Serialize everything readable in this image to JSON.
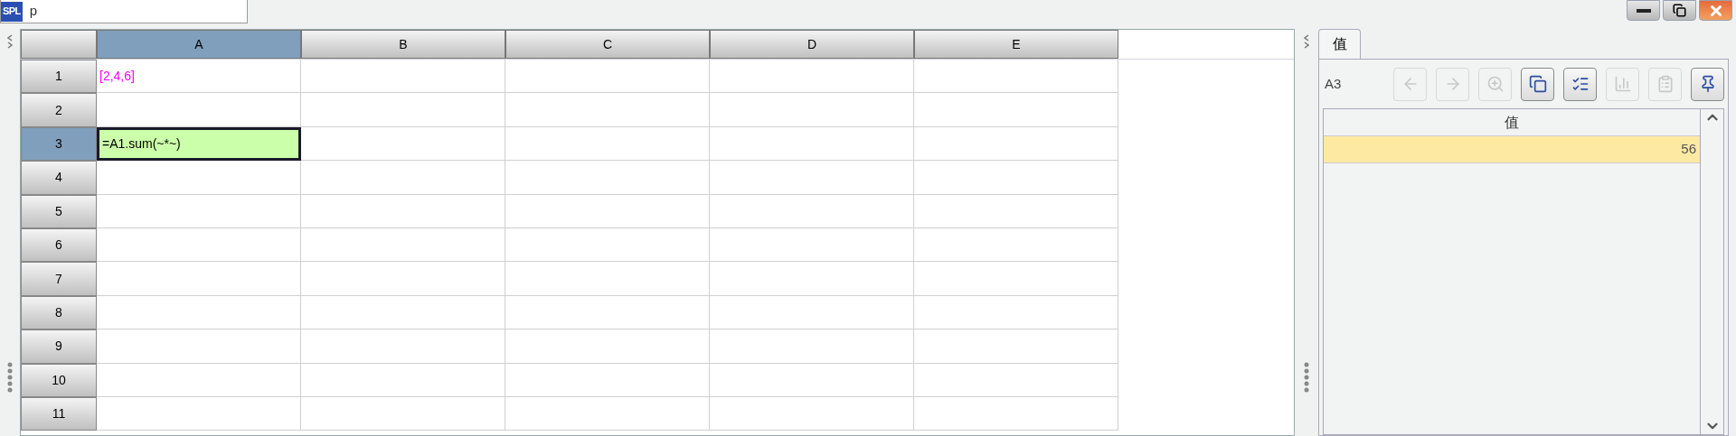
{
  "document_tab": {
    "logo": "SPL",
    "title": "p"
  },
  "grid": {
    "columns": [
      {
        "label": "A",
        "selected": true
      },
      {
        "label": "B",
        "selected": false
      },
      {
        "label": "C",
        "selected": false
      },
      {
        "label": "D",
        "selected": false
      },
      {
        "label": "E",
        "selected": false
      }
    ],
    "rows": [
      {
        "label": "1",
        "selected": false,
        "cells": [
          {
            "text": "[2,4,6]",
            "kind": "constant",
            "selected": false
          },
          {
            "selected": false
          },
          {
            "selected": false
          },
          {
            "selected": false
          },
          {
            "selected": false
          }
        ]
      },
      {
        "label": "2",
        "selected": false,
        "cells": [
          {
            "selected": false
          },
          {
            "selected": false
          },
          {
            "selected": false
          },
          {
            "selected": false
          },
          {
            "selected": false
          }
        ]
      },
      {
        "label": "3",
        "selected": true,
        "cells": [
          {
            "text": "=A1.sum(~*~)",
            "kind": "formula",
            "selected": true
          },
          {
            "selected": false
          },
          {
            "selected": false
          },
          {
            "selected": false
          },
          {
            "selected": false
          }
        ]
      },
      {
        "label": "4",
        "selected": false,
        "cells": [
          {
            "selected": false
          },
          {
            "selected": false
          },
          {
            "selected": false
          },
          {
            "selected": false
          },
          {
            "selected": false
          }
        ]
      },
      {
        "label": "5",
        "selected": false,
        "cells": [
          {
            "selected": false
          },
          {
            "selected": false
          },
          {
            "selected": false
          },
          {
            "selected": false
          },
          {
            "selected": false
          }
        ]
      },
      {
        "label": "6",
        "selected": false,
        "cells": [
          {
            "selected": false
          },
          {
            "selected": false
          },
          {
            "selected": false
          },
          {
            "selected": false
          },
          {
            "selected": false
          }
        ]
      },
      {
        "label": "7",
        "selected": false,
        "cells": [
          {
            "selected": false
          },
          {
            "selected": false
          },
          {
            "selected": false
          },
          {
            "selected": false
          },
          {
            "selected": false
          }
        ]
      },
      {
        "label": "8",
        "selected": false,
        "cells": [
          {
            "selected": false
          },
          {
            "selected": false
          },
          {
            "selected": false
          },
          {
            "selected": false
          },
          {
            "selected": false
          }
        ]
      },
      {
        "label": "9",
        "selected": false,
        "cells": [
          {
            "selected": false
          },
          {
            "selected": false
          },
          {
            "selected": false
          },
          {
            "selected": false
          },
          {
            "selected": false
          }
        ]
      },
      {
        "label": "10",
        "selected": false,
        "cells": [
          {
            "selected": false
          },
          {
            "selected": false
          },
          {
            "selected": false
          },
          {
            "selected": false
          },
          {
            "selected": false
          }
        ]
      },
      {
        "label": "11",
        "selected": false,
        "cells": [
          {
            "selected": false
          },
          {
            "selected": false
          },
          {
            "selected": false
          },
          {
            "selected": false
          },
          {
            "selected": false
          }
        ]
      }
    ]
  },
  "value_panel": {
    "tabs": [
      {
        "label": "值",
        "selected": true
      }
    ],
    "cell_ref": "A3",
    "toolbar": [
      {
        "disabled": true
      },
      {
        "disabled": true
      },
      {
        "disabled": true
      },
      {
        "disabled": false
      },
      {
        "disabled": false
      },
      {
        "disabled": true
      },
      {
        "disabled": true
      },
      {
        "disabled": false
      }
    ],
    "table": {
      "columns": [
        "值"
      ],
      "rows": [
        {
          "value": "56",
          "selected": true
        }
      ]
    }
  }
}
